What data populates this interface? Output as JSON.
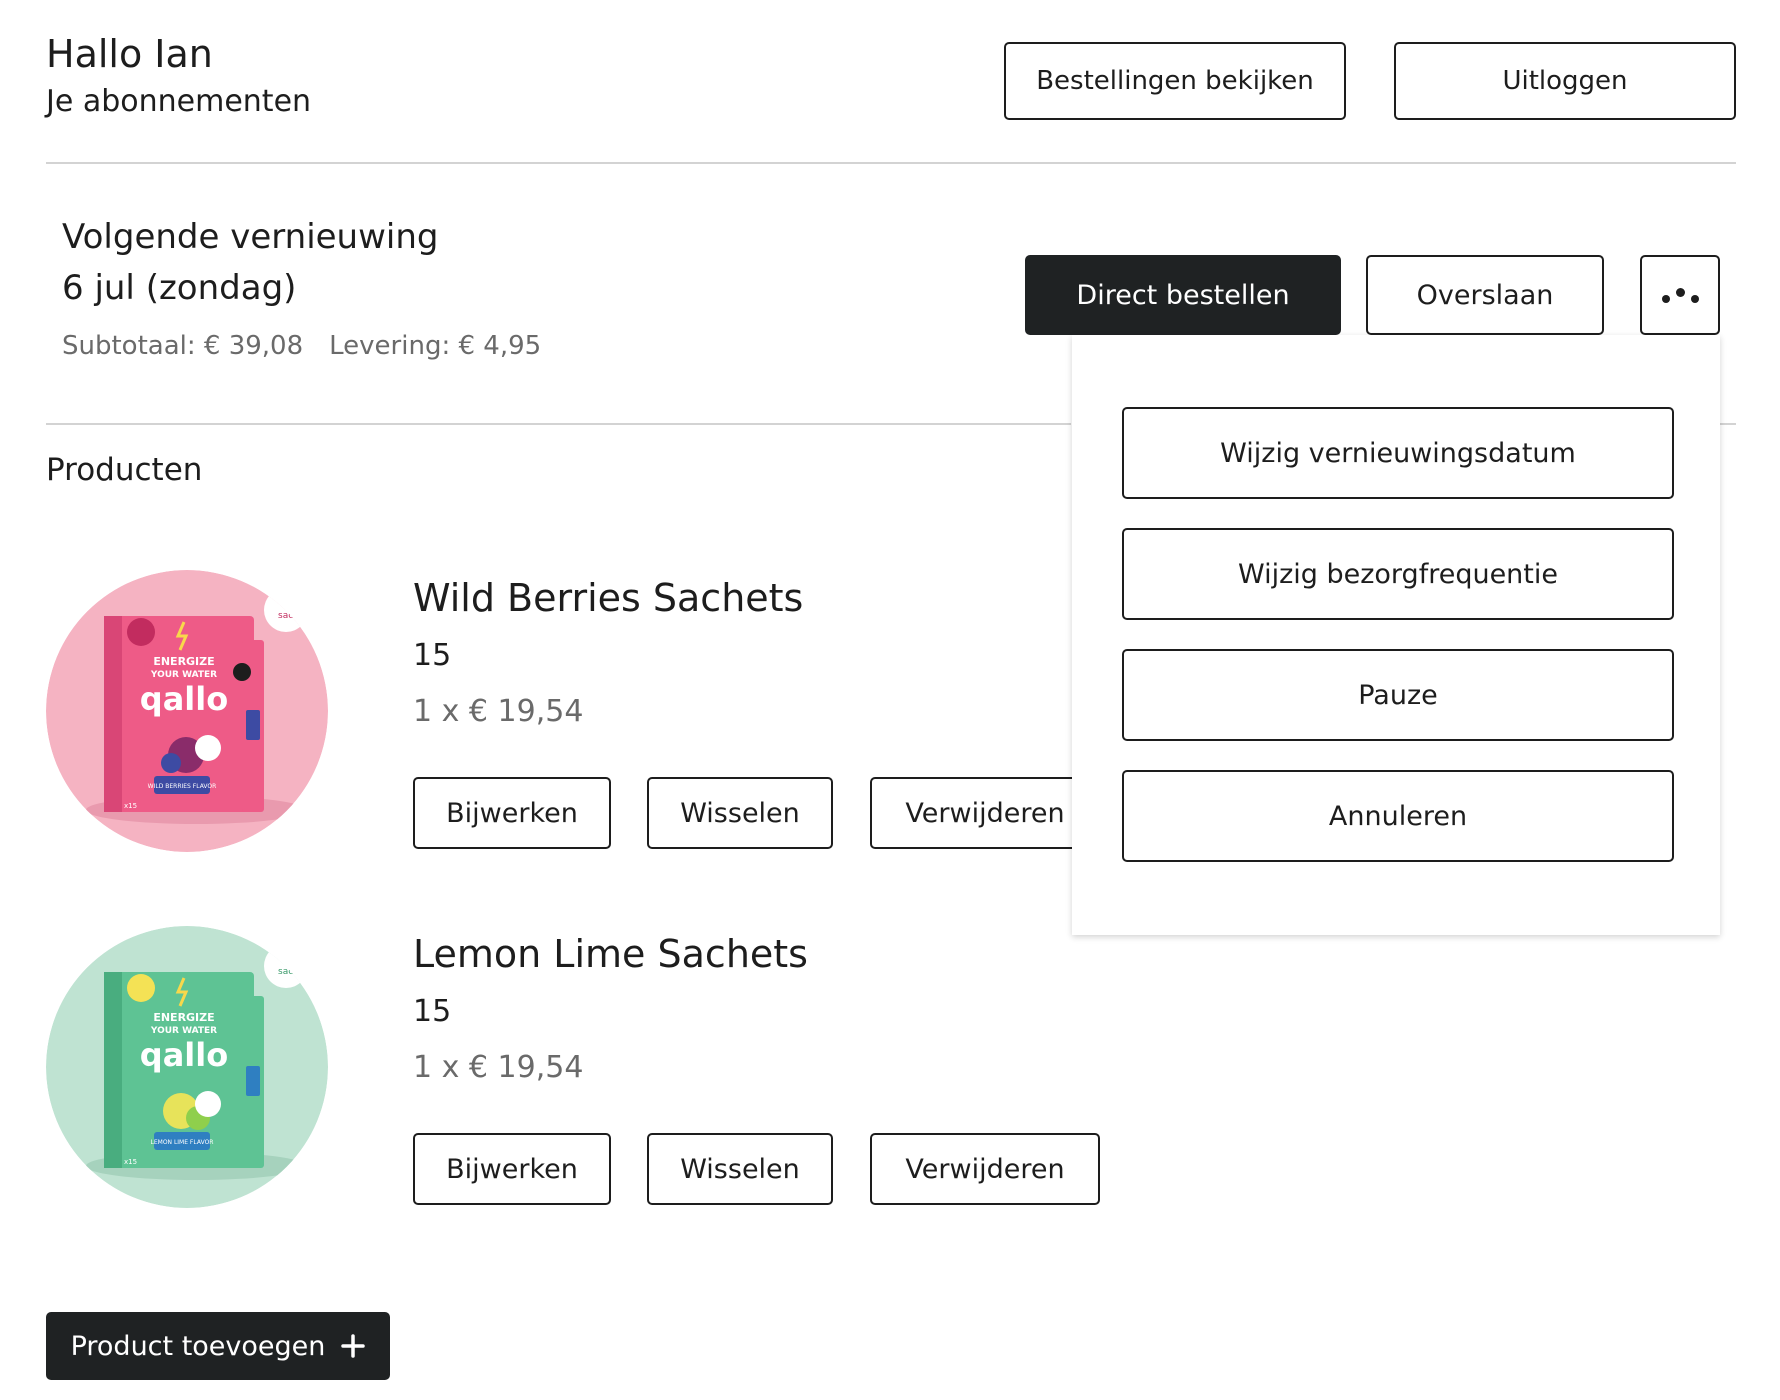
{
  "header": {
    "greeting": "Hallo Ian",
    "subtitle": "Je abonnementen",
    "orders_button": "Bestellingen bekijken",
    "logout_button": "Uitloggen"
  },
  "renewal": {
    "title": "Volgende vernieuwing",
    "date": "6 jul (zondag)",
    "subtotal": "Subtotaal: € 39,08",
    "delivery": "Levering: € 4,95",
    "order_now_button": "Direct bestellen",
    "skip_button": "Overslaan",
    "more_icon": "more-dots-icon"
  },
  "dropdown": {
    "items": [
      "Wijzig vernieuwingsdatum",
      "Wijzig bezorgfrequentie",
      "Pauze",
      "Annuleren"
    ]
  },
  "products": {
    "label": "Producten",
    "items": [
      {
        "name": "Wild Berries Sachets",
        "qty": "15",
        "price": "1 x € 19,54",
        "image_bg": "#f5b3c2",
        "box_color": "#ee5b87",
        "image_text": {
          "line1": "ENERGIZE",
          "line2": "YOUR WATER",
          "brand": "qallo",
          "flavor": "WILD BERRIES FLAVOR",
          "count": "x15",
          "badge": "sach"
        },
        "actions": [
          "Bijwerken",
          "Wisselen",
          "Verwijderen"
        ]
      },
      {
        "name": "Lemon Lime Sachets",
        "qty": "15",
        "price": "1 x € 19,54",
        "image_bg": "#bfe3d2",
        "box_color": "#5ec394",
        "image_text": {
          "line1": "ENERGIZE",
          "line2": "YOUR WATER",
          "brand": "qallo",
          "flavor": "LEMON LIME FLAVOR",
          "count": "x15",
          "badge": "sach"
        },
        "actions": [
          "Bijwerken",
          "Wisselen",
          "Verwijderen"
        ]
      }
    ],
    "add_button": "Product toevoegen",
    "add_icon": "plus-icon"
  },
  "colors": {
    "dark_button": "#1f2223",
    "border": "#1d1d1d",
    "divider": "#d3d3d3",
    "muted_text": "#6a6a6a"
  }
}
